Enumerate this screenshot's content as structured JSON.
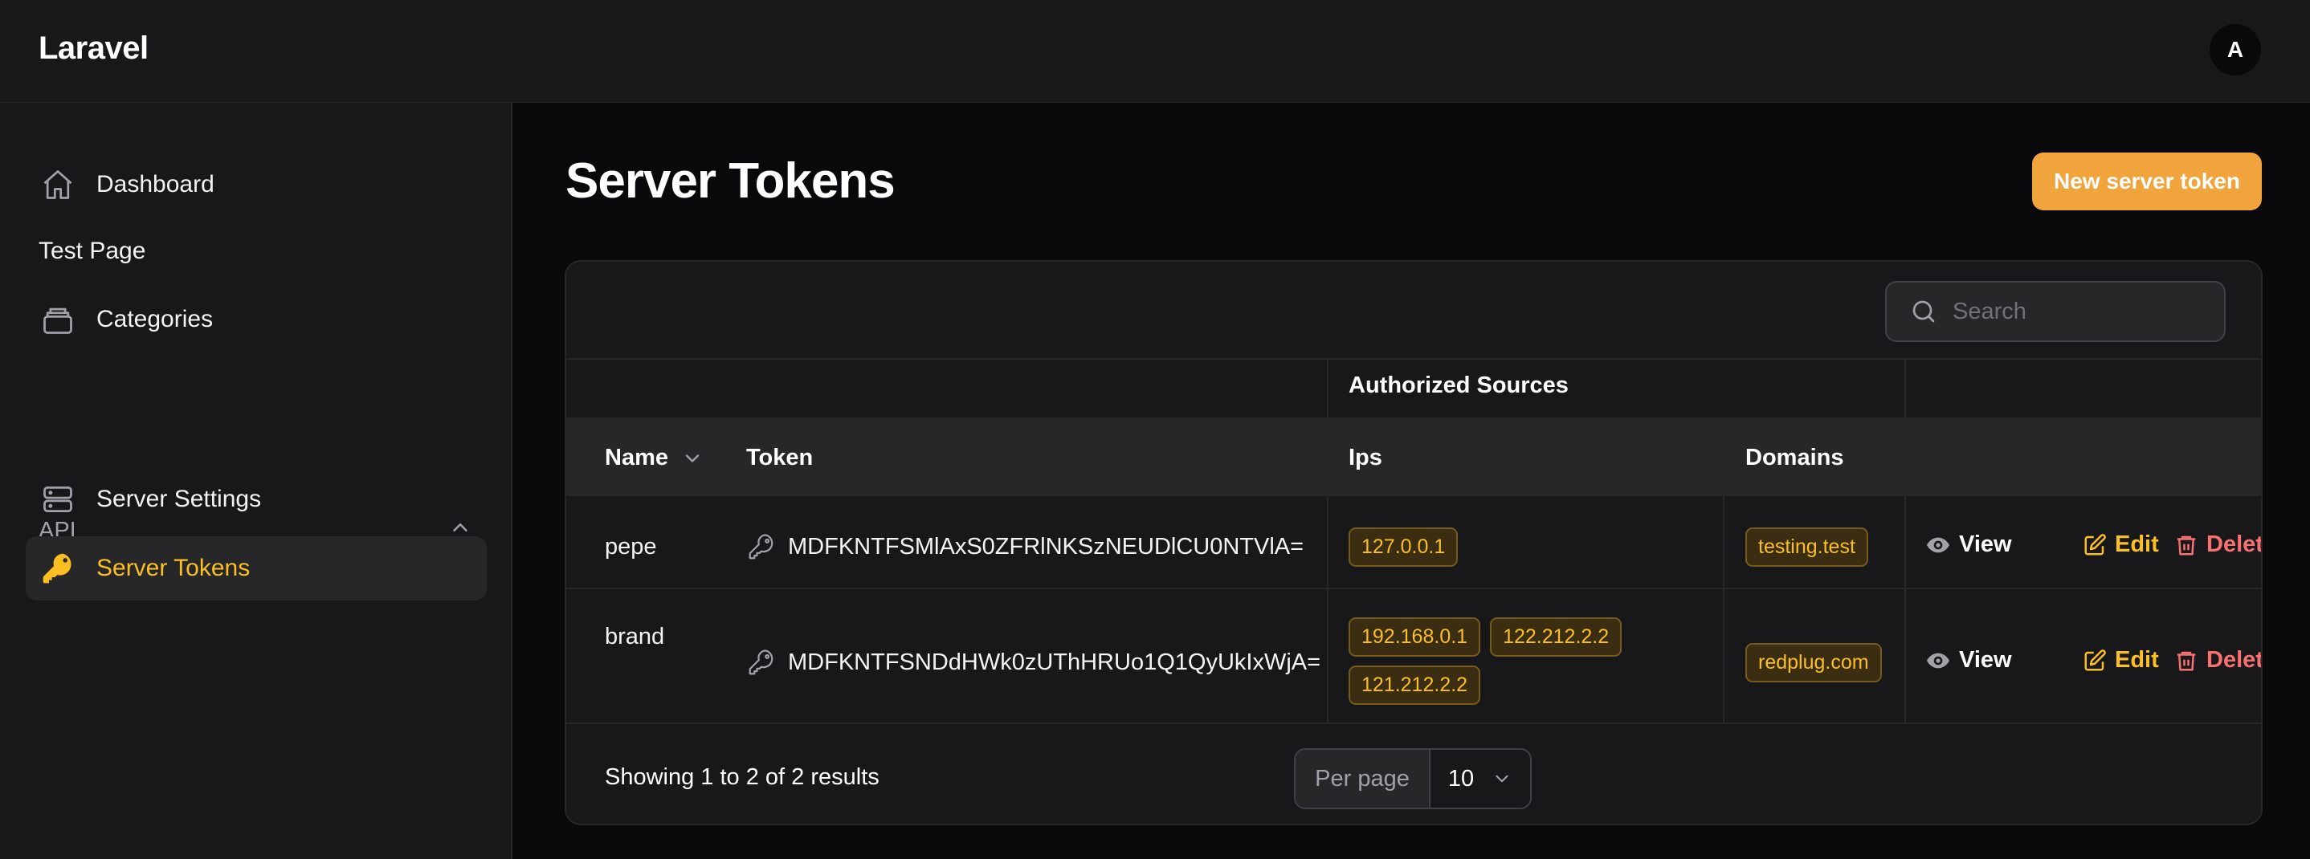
{
  "app": {
    "brand": "Laravel",
    "user_initial": "A"
  },
  "sidebar": {
    "dashboard": "Dashboard",
    "test_page": "Test Page",
    "categories": "Categories",
    "group_label": "API",
    "server_settings": "Server Settings",
    "server_tokens": "Server Tokens"
  },
  "page": {
    "title": "Server Tokens",
    "new_button": "New server token"
  },
  "search": {
    "placeholder": "Search"
  },
  "table": {
    "group_header": "Authorized Sources",
    "columns": {
      "name": "Name",
      "token": "Token",
      "ips": "Ips",
      "domains": "Domains"
    },
    "rows": [
      {
        "name": "pepe",
        "token": "MDFKNTFSMlAxS0ZFRlNKSzNEUDlCU0NTVlA=",
        "ips": [
          "127.0.0.1"
        ],
        "domains": [
          "testing.test"
        ]
      },
      {
        "name": "brand",
        "token": "MDFKNTFSNDdHWk0zUThHRUo1Q1QyUkIxWjA=",
        "ips": [
          "192.168.0.1",
          "122.212.2.2",
          "121.212.2.2"
        ],
        "domains": [
          "redplug.com"
        ]
      }
    ],
    "actions": {
      "view": "View",
      "edit": "Edit",
      "delete": "Delete"
    }
  },
  "footer": {
    "summary": "Showing 1 to 2 of 2 results",
    "per_page_label": "Per page",
    "per_page_value": "10"
  },
  "colors": {
    "accent": "#f1a33c",
    "active": "#fbbf24",
    "danger": "#f87171",
    "bg": "#09090b",
    "panel": "#18181b"
  }
}
